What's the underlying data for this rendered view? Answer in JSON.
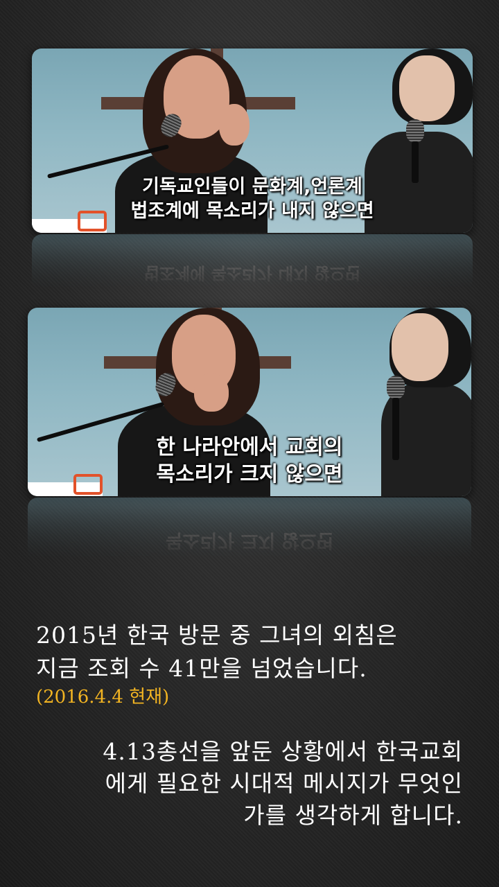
{
  "panel1": {
    "subtitle_line1": "기독교인들이 문화계,언론계",
    "subtitle_line2": "법조계에 목소리가 내지 않으면"
  },
  "panel2": {
    "subtitle_line1": "한 나라안에서 교회의",
    "subtitle_line2": "목소리가 크지 않으면"
  },
  "caption": {
    "line1": "2015년 한국 방문 중 그녀의 외침은",
    "line2": "지금 조회 수 41만을 넘었습니다.",
    "date_note": "(2016.4.4 현재)",
    "para_line1": "4.13총선을 앞둔 상황에서 한국교회",
    "para_line2": "에게 필요한 시대적 메시지가 무엇인",
    "para_line3": "가를 생각하게 합니다."
  },
  "colors": {
    "date_note": "#f2b422",
    "logo_accent": "#e2522a"
  }
}
